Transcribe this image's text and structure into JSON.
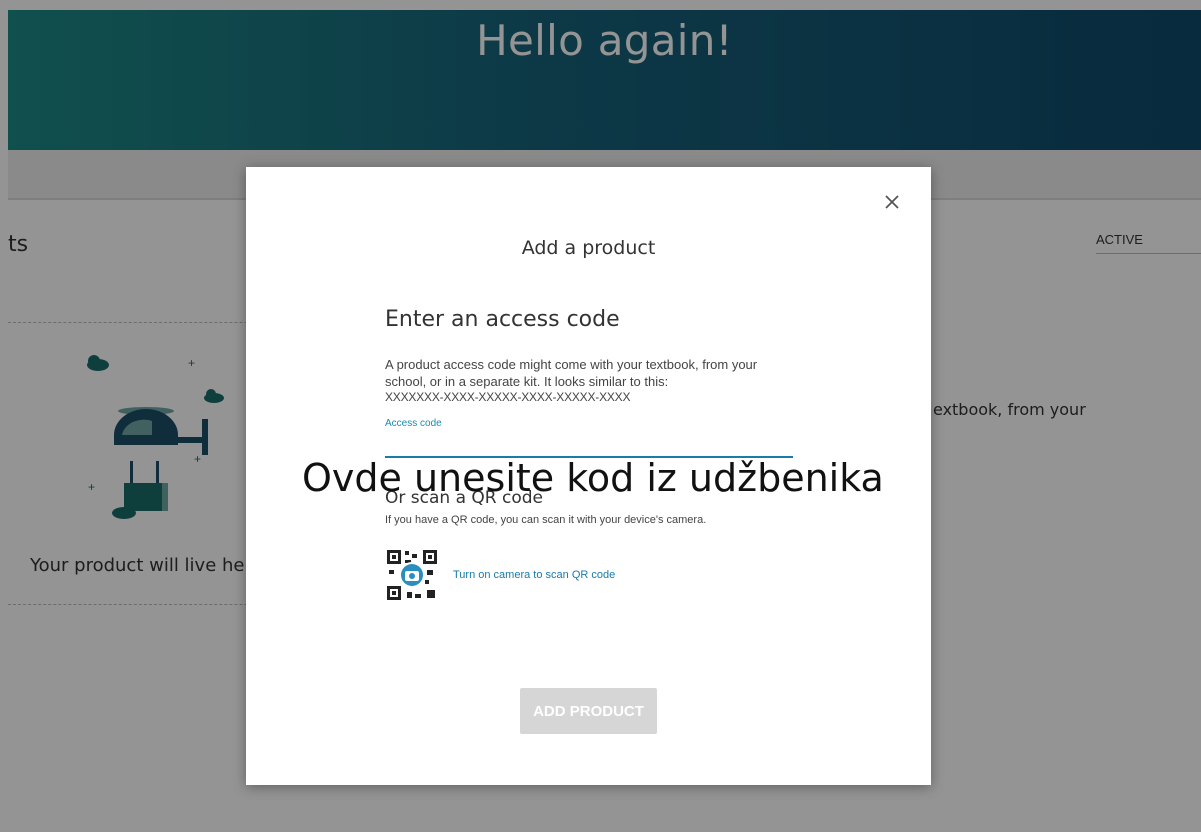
{
  "hero": {
    "title": "Hello again!"
  },
  "background": {
    "section_title": "ts",
    "filter_value": "ACTIVE",
    "empty_text": "Your product will live he",
    "side_text": "extbook, from your"
  },
  "modal": {
    "title": "Add a product",
    "heading": "Enter an access code",
    "description": "A product access code might come with your textbook, from your school, or in a separate kit. It looks similar to this:",
    "example_code": "XXXXXXX-XXXX-XXXXX-XXXX-XXXXX-XXXX",
    "field_label": "Access code",
    "field_value": "",
    "qr_heading": "Or scan a QR code",
    "qr_description": "If you have a QR code, you can scan it with your device's camera.",
    "qr_link": "Turn on camera to scan QR code",
    "add_button": "ADD PRODUCT",
    "close_icon": "close-icon",
    "qr_icon": "qr-camera-icon"
  },
  "annotation": {
    "text": "Ovde unesite kod iz udžbenika"
  },
  "colors": {
    "hero_start": "#1d8a86",
    "hero_end": "#0f4a6a",
    "accent": "#1a7aa8",
    "button_disabled": "#d6d6d6"
  }
}
